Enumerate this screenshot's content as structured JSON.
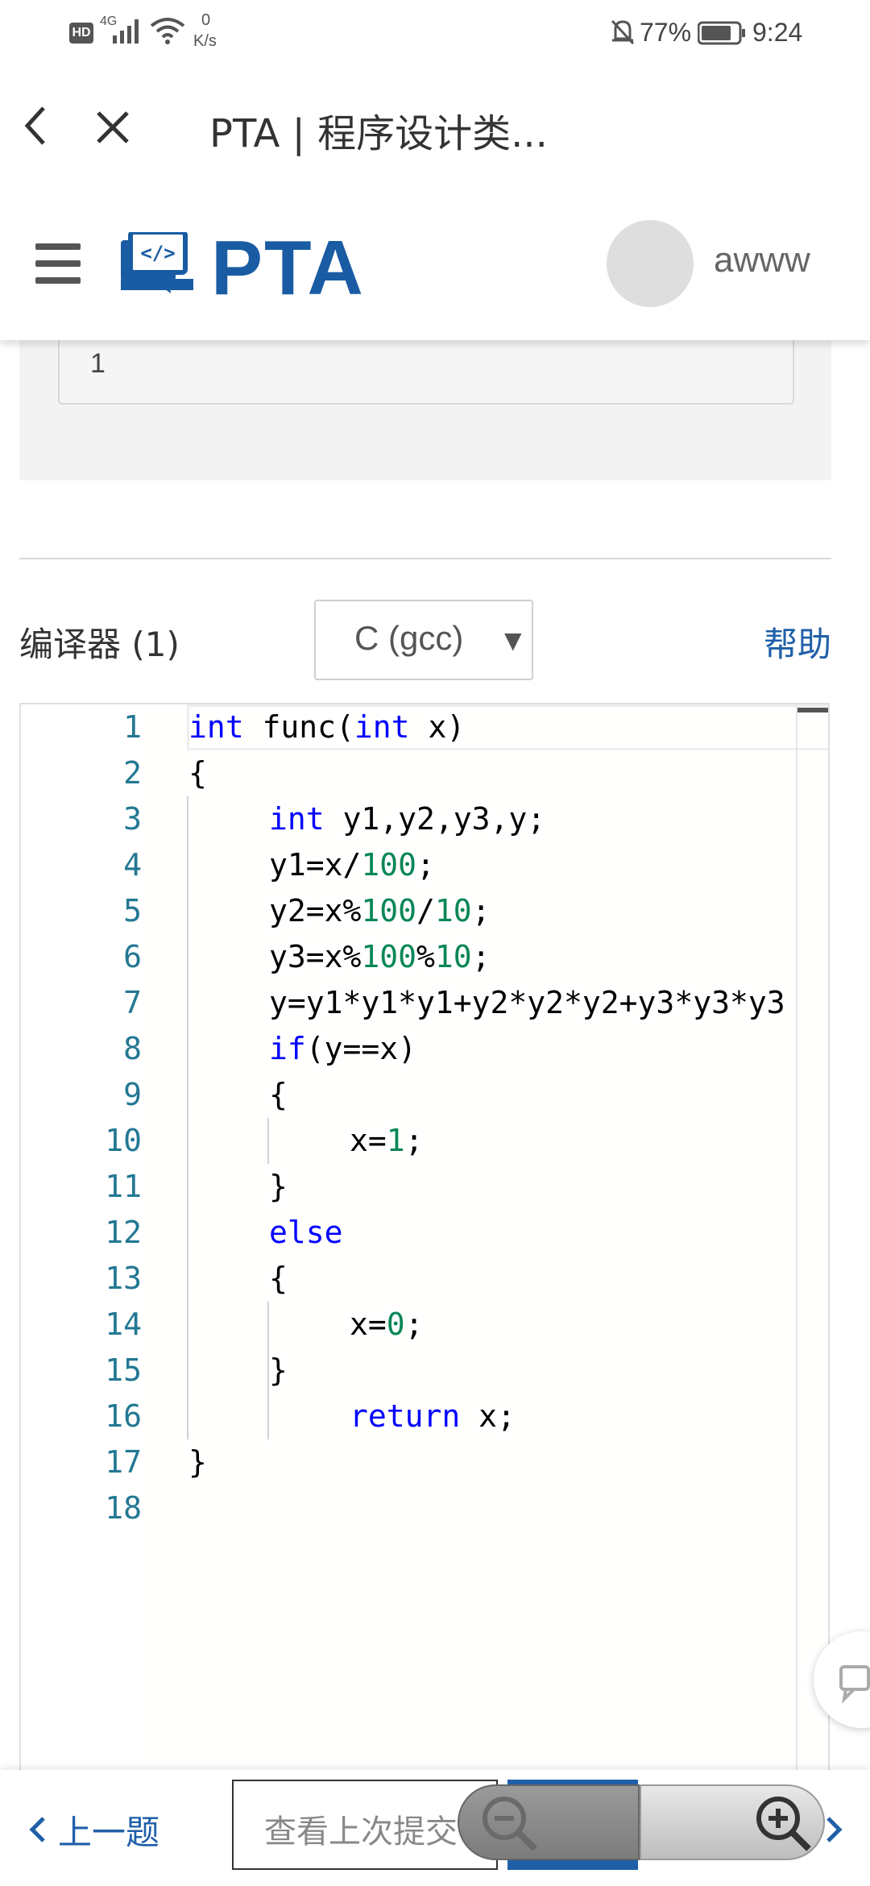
{
  "status_bar": {
    "network_type": "HD",
    "signal": "4G",
    "speed_value": "0",
    "speed_unit": "K/s",
    "battery": "77%",
    "time": "9:24"
  },
  "nav": {
    "title": "PTA | 程序设计类..."
  },
  "header": {
    "logo_text": "PTA",
    "username": "awww"
  },
  "sample": {
    "value": "1"
  },
  "compiler": {
    "label": "编译器 (1)",
    "language": "C (gcc)",
    "help": "帮助"
  },
  "editor": {
    "lines": [
      {
        "n": "1",
        "segs": [
          {
            "t": "int",
            "c": "kw"
          },
          {
            "t": " func(",
            "c": ""
          },
          {
            "t": "int",
            "c": "kw"
          },
          {
            "t": " x)",
            "c": ""
          }
        ],
        "indent": 0
      },
      {
        "n": "2",
        "segs": [
          {
            "t": "{",
            "c": ""
          }
        ],
        "indent": 0
      },
      {
        "n": "3",
        "segs": [
          {
            "t": "int",
            "c": "kw"
          },
          {
            "t": " y1,y2,y3,y;",
            "c": ""
          }
        ],
        "indent": 1
      },
      {
        "n": "4",
        "segs": [
          {
            "t": "y1=x/",
            "c": ""
          },
          {
            "t": "100",
            "c": "num"
          },
          {
            "t": ";",
            "c": ""
          }
        ],
        "indent": 1
      },
      {
        "n": "5",
        "segs": [
          {
            "t": "y2=x%",
            "c": ""
          },
          {
            "t": "100",
            "c": "num"
          },
          {
            "t": "/",
            "c": ""
          },
          {
            "t": "10",
            "c": "num"
          },
          {
            "t": ";",
            "c": ""
          }
        ],
        "indent": 1
      },
      {
        "n": "6",
        "segs": [
          {
            "t": "y3=x%",
            "c": ""
          },
          {
            "t": "100",
            "c": "num"
          },
          {
            "t": "%",
            "c": ""
          },
          {
            "t": "10",
            "c": "num"
          },
          {
            "t": ";",
            "c": ""
          }
        ],
        "indent": 1
      },
      {
        "n": "7",
        "segs": [
          {
            "t": "y=y1*y1*y1+y2*y2*y2+y3*y3*y3",
            "c": ""
          }
        ],
        "indent": 1
      },
      {
        "n": "8",
        "segs": [
          {
            "t": "if",
            "c": "kw"
          },
          {
            "t": "(y==x)",
            "c": ""
          }
        ],
        "indent": 1
      },
      {
        "n": "9",
        "segs": [
          {
            "t": "{",
            "c": ""
          }
        ],
        "indent": 1
      },
      {
        "n": "10",
        "segs": [
          {
            "t": "x=",
            "c": ""
          },
          {
            "t": "1",
            "c": "num"
          },
          {
            "t": ";",
            "c": ""
          }
        ],
        "indent": 2
      },
      {
        "n": "11",
        "segs": [
          {
            "t": "}",
            "c": ""
          }
        ],
        "indent": 1
      },
      {
        "n": "12",
        "segs": [
          {
            "t": "else",
            "c": "kw"
          }
        ],
        "indent": 1
      },
      {
        "n": "13",
        "segs": [
          {
            "t": "{",
            "c": ""
          }
        ],
        "indent": 1
      },
      {
        "n": "14",
        "segs": [
          {
            "t": "x=",
            "c": ""
          },
          {
            "t": "0",
            "c": "num"
          },
          {
            "t": ";",
            "c": ""
          }
        ],
        "indent": 2
      },
      {
        "n": "15",
        "segs": [
          {
            "t": "}",
            "c": ""
          }
        ],
        "indent": 1
      },
      {
        "n": "16",
        "segs": [
          {
            "t": "return",
            "c": "kw"
          },
          {
            "t": " x;",
            "c": ""
          }
        ],
        "indent": 2
      },
      {
        "n": "17",
        "segs": [
          {
            "t": "}",
            "c": ""
          }
        ],
        "indent": 0
      },
      {
        "n": "18",
        "segs": [],
        "indent": 0
      }
    ]
  },
  "bottom": {
    "prev": "上一题",
    "history": "查看上次提交"
  },
  "colors": {
    "brand": "#1f5fa8",
    "keyword": "#0000ff",
    "number": "#098658",
    "line_number": "#237893"
  }
}
